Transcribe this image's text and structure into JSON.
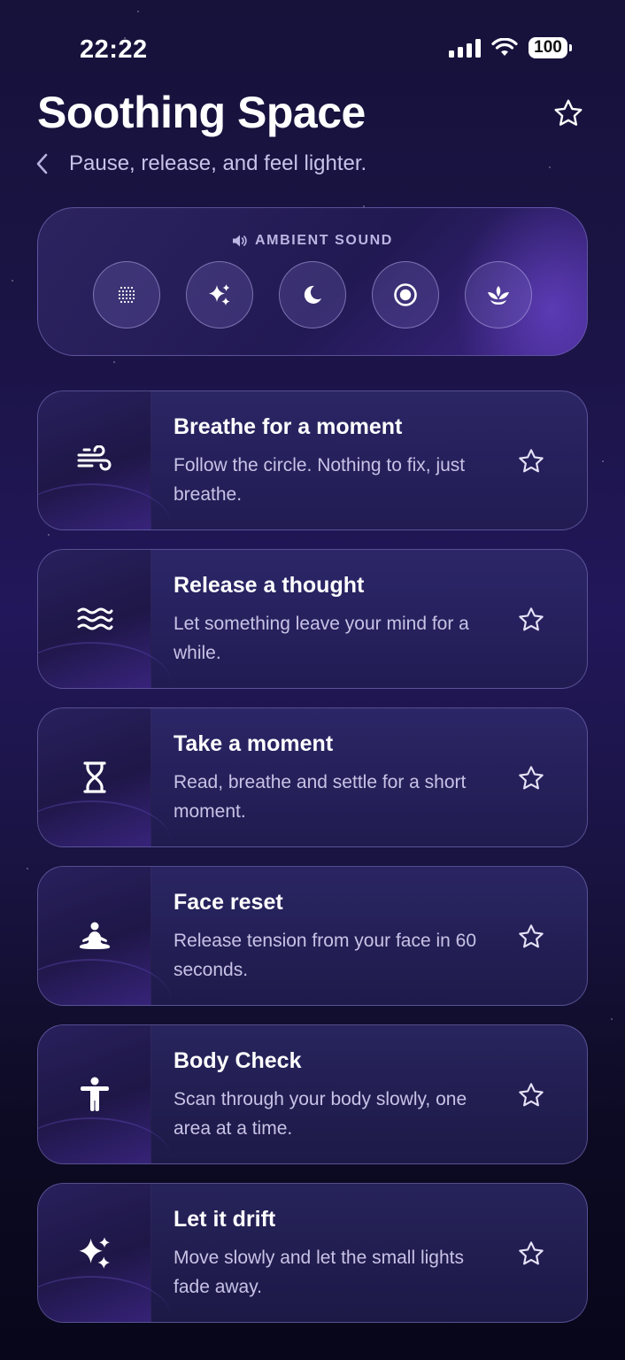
{
  "status_bar": {
    "time": "22:22",
    "battery": "100"
  },
  "header": {
    "title": "Soothing Space",
    "subtitle": "Pause, release, and feel lighter."
  },
  "ambient": {
    "label": "AMBIENT SOUND",
    "sounds": [
      {
        "icon": "noise-dots-icon"
      },
      {
        "icon": "sparkles-icon"
      },
      {
        "icon": "moon-icon"
      },
      {
        "icon": "record-circle-icon"
      },
      {
        "icon": "lotus-icon"
      }
    ]
  },
  "cards": [
    {
      "title": "Breathe for a moment",
      "description": "Follow the circle. Nothing to fix, just breathe.",
      "icon": "wind-icon"
    },
    {
      "title": "Release a thought",
      "description": "Let something leave your mind for a while.",
      "icon": "waves-icon"
    },
    {
      "title": "Take a moment",
      "description": "Read, breathe and settle for a short moment.",
      "icon": "hourglass-icon"
    },
    {
      "title": "Face reset",
      "description": "Release tension from your face in 60 seconds.",
      "icon": "meditation-icon"
    },
    {
      "title": "Body Check",
      "description": "Scan through your body slowly, one area at a time.",
      "icon": "body-figure-icon"
    },
    {
      "title": "Let it drift",
      "description": "Move slowly and let the small lights fade away.",
      "icon": "sparkles-icon"
    }
  ]
}
